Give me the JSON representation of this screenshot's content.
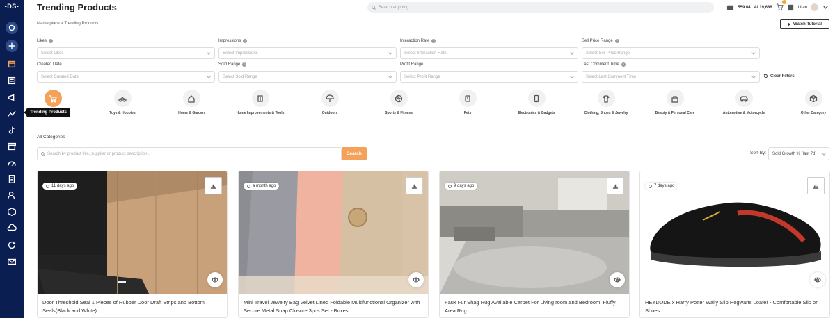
{
  "app": {
    "logo": "-DS-"
  },
  "page": {
    "title": "Trending Products",
    "breadcrumb": "Marketplace > Trending Products"
  },
  "header": {
    "search_placeholder": "Search anything",
    "credits": "559.04",
    "ai_credits": "AI 19,686",
    "cart_count": "1",
    "user_name": "Liran",
    "watch_tutorial": "Watch Tutorial"
  },
  "tooltip": "Trending Products",
  "filters": {
    "likes": {
      "label": "Likes",
      "placeholder": "Select Likes"
    },
    "impressions": {
      "label": "Impressions",
      "placeholder": "Select Impressions"
    },
    "interaction_rate": {
      "label": "Interaction Rate",
      "placeholder": "Select Interaction Rate"
    },
    "sell_price": {
      "label": "Sell Price Range",
      "placeholder": "Select Sell Price Range"
    },
    "created_date": {
      "label": "Created Date",
      "placeholder": "Select Created Date"
    },
    "sold_range": {
      "label": "Sold Range",
      "placeholder": "Select Sold Range"
    },
    "profit_range": {
      "label": "Profit Range",
      "placeholder": "Select Profit Range"
    },
    "last_comment": {
      "label": "Last Comment Time",
      "placeholder": "Select Last Comment Time"
    },
    "clear": "Clear Filters"
  },
  "categories": [
    {
      "label": "",
      "icon": "cart-icon"
    },
    {
      "label": "Toys & Hobbies",
      "icon": "bike-icon"
    },
    {
      "label": "Home & Garden",
      "icon": "house-icon"
    },
    {
      "label": "Home Improvements & Tools",
      "icon": "tools-icon"
    },
    {
      "label": "Outdoors",
      "icon": "umbrella-icon"
    },
    {
      "label": "Sports & Fitness",
      "icon": "ball-icon"
    },
    {
      "label": "Pets",
      "icon": "pet-icon"
    },
    {
      "label": "Electronics & Gadgets",
      "icon": "phone-icon"
    },
    {
      "label": "Clothing, Shoes & Jewelry",
      "icon": "clothing-icon"
    },
    {
      "label": "Beauty & Personal Care",
      "icon": "beauty-icon"
    },
    {
      "label": "Automotive & Motorcycle",
      "icon": "car-icon"
    },
    {
      "label": "Other Category",
      "icon": "box-icon"
    }
  ],
  "all_categories": "All Categories",
  "product_search": {
    "placeholder": "Search by product title, supplier or product description...",
    "button": "Search"
  },
  "sort": {
    "label": "Sort By:",
    "value": "Sold Growth % (last 7d)"
  },
  "products": [
    {
      "ago": "11 days ago",
      "title": "Door Threshold Seal 1 Pieces of Rubber Door Draft Strips and Bottom Seals(Black and White)"
    },
    {
      "ago": "a month ago",
      "title": "Mini Travel Jewelry Bag Velvet Lined Foldable Multifunctional Organizer with Secure Metal Snap Closure 3pcs Set - Boxes"
    },
    {
      "ago": "9 days ago",
      "title": "Faux Fur Shag Rug Available Carpet For Living room and Bedroom, Fluffy Area Rug"
    },
    {
      "ago": "7 days ago",
      "title": "HEYDUDE x Harry Potter Wally Slip Hogwarts Loafer - Comfortable Slip on Shoes"
    }
  ]
}
